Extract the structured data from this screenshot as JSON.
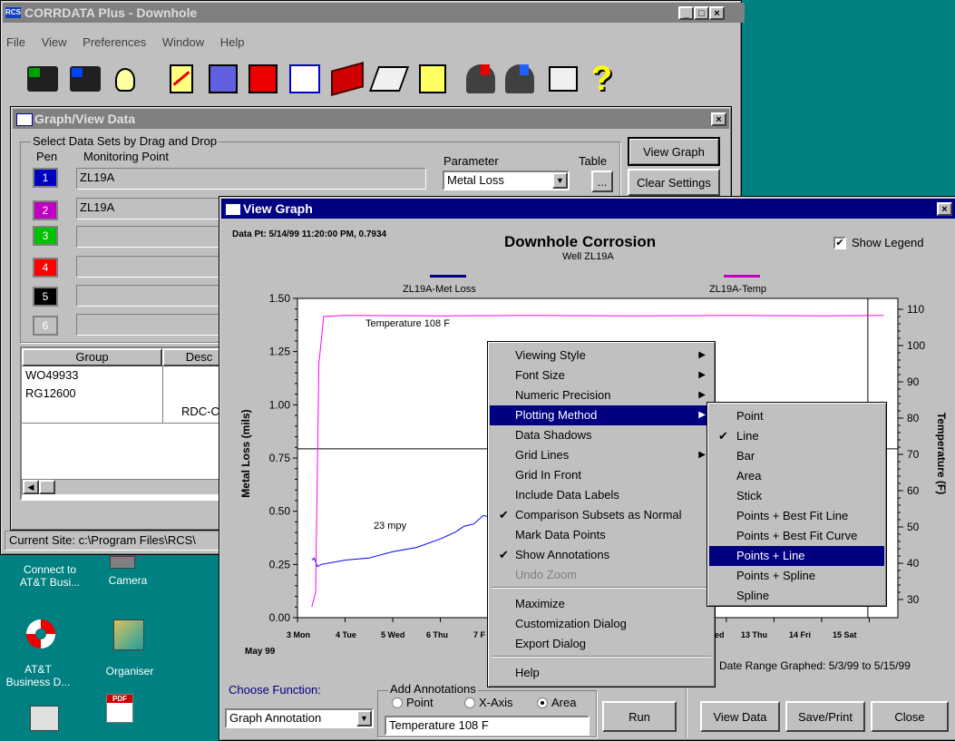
{
  "main_window": {
    "title": "CORRDATA Plus - Downhole",
    "menu": [
      "File",
      "View",
      "Preferences",
      "Window",
      "Help"
    ],
    "status": "Current Site: c:\\Program Files\\RCS\\"
  },
  "graph_view_data": {
    "title": "Graph/View Data",
    "group_title": "Select Data Sets by Drag and Drop",
    "col_pen": "Pen",
    "col_monitoring": "Monitoring Point",
    "col_parameter": "Parameter",
    "col_table": "Table",
    "pens": [
      {
        "num": "1",
        "color": "#0000c0",
        "point": "ZL19A"
      },
      {
        "num": "2",
        "color": "#c000c0",
        "point": "ZL19A"
      },
      {
        "num": "3",
        "color": "#00c000",
        "point": ""
      },
      {
        "num": "4",
        "color": "#ff0000",
        "point": ""
      },
      {
        "num": "5",
        "color": "#000000",
        "point": ""
      },
      {
        "num": "6",
        "color": "#c0c0c0",
        "point": ""
      }
    ],
    "parameter_value": "Metal Loss",
    "table_btn": "...",
    "view_graph_btn": "View Graph",
    "clear_settings_btn": "Clear Settings",
    "group_header": "Group",
    "desc_header": "Desc",
    "groups": [
      "WO49933",
      "RG12600",
      ""
    ],
    "desc_values": [
      "",
      "",
      "RDC-CO"
    ]
  },
  "view_graph": {
    "title": "View Graph",
    "data_pt": "Data Pt: 5/14/99 11:20:00 PM, 0.7934",
    "chart_title": "Downhole Corrosion",
    "chart_subtitle": "Well ZL19A",
    "show_legend": "Show Legend",
    "legend": [
      {
        "name": "ZL19A-Met Loss",
        "color": "#000080"
      },
      {
        "name": "ZL19A-Temp",
        "color": "#c000c0"
      }
    ],
    "ylabel_left": "Metal Loss (mils)",
    "ylabel_right": "Temperature (F)",
    "annotation_temp": "Temperature 108 F",
    "annotation_mpy": "23 mpy",
    "x_ticks_left": [
      "3 Mon",
      "4 Tue",
      "5 Wed",
      "6 Thu",
      "7 F"
    ],
    "x_ticks_right": [
      "ed",
      "13 Thu",
      "14 Fri",
      "15 Sat"
    ],
    "month_label": "May 99",
    "date_range": "Date Range Graphed: 5/3/99 to 5/15/99",
    "choose_function_label": "Choose Function:",
    "choose_function_value": "Graph Annotation",
    "add_annotations_label": "Add Annotations",
    "radio_point": "Point",
    "radio_xaxis": "X-Axis",
    "radio_area": "Area",
    "annotation_text": "Temperature 108 F",
    "run_btn": "Run",
    "view_data_btn": "View Data",
    "save_print_btn": "Save/Print",
    "close_btn": "Close"
  },
  "context_menu": [
    {
      "label": "Viewing Style",
      "submenu": true
    },
    {
      "label": "Font Size",
      "submenu": true
    },
    {
      "label": "Numeric Precision",
      "submenu": true
    },
    {
      "label": "Plotting Method",
      "submenu": true,
      "selected": true
    },
    {
      "label": "Data Shadows"
    },
    {
      "label": "Grid Lines",
      "submenu": true
    },
    {
      "label": "Grid In Front"
    },
    {
      "label": "Include Data Labels"
    },
    {
      "label": "Comparison Subsets as Normal",
      "checked": true
    },
    {
      "label": "Mark Data Points"
    },
    {
      "label": "Show Annotations",
      "checked": true
    },
    {
      "label": "Undo Zoom",
      "disabled": true
    },
    {
      "label": "Maximize"
    },
    {
      "label": "Customization Dialog"
    },
    {
      "label": "Export Dialog"
    },
    {
      "label": "Help"
    }
  ],
  "submenu": [
    {
      "label": "Point"
    },
    {
      "label": "Line",
      "checked": true
    },
    {
      "label": "Bar"
    },
    {
      "label": "Area"
    },
    {
      "label": "Stick"
    },
    {
      "label": "Points + Best Fit Line"
    },
    {
      "label": "Points + Best Fit Curve"
    },
    {
      "label": "Points + Line",
      "selected": true
    },
    {
      "label": "Points + Spline"
    },
    {
      "label": "Spline"
    }
  ],
  "desktop": [
    {
      "label": "Connect to AT&T Busi...",
      "icon": "connect-icon"
    },
    {
      "label": "Camera",
      "icon": "camera-icon"
    },
    {
      "label": "AT&T Business D...",
      "icon": "lifebuoy-icon"
    },
    {
      "label": "Organiser",
      "icon": "organiser-icon"
    }
  ],
  "chart_data": {
    "type": "line",
    "title": "Downhole Corrosion",
    "subtitle": "Well ZL19A",
    "ylabel": "Metal Loss (mils)",
    "y2label": "Temperature (F)",
    "ylim": [
      0,
      1.5
    ],
    "y2lim": [
      25,
      113
    ],
    "y_ticks": [
      "0.00",
      "0.25",
      "0.50",
      "0.75",
      "1.00",
      "1.25",
      "1.50"
    ],
    "y2_ticks": [
      "30",
      "40",
      "50",
      "60",
      "70",
      "80",
      "90",
      "100",
      "110"
    ],
    "series": [
      {
        "name": "ZL19A-Met Loss",
        "color": "#0000ff",
        "axis": "left",
        "x": [
          3.3,
          3.35,
          3.42,
          3.5,
          4.0,
          4.5,
          5.0,
          5.5,
          6.0,
          6.3,
          6.5,
          6.7,
          6.9,
          7.1,
          7.3
        ],
        "y": [
          0.27,
          0.28,
          0.24,
          0.25,
          0.27,
          0.28,
          0.31,
          0.33,
          0.37,
          0.4,
          0.43,
          0.44,
          0.48,
          0.47,
          0.5
        ]
      },
      {
        "name": "ZL19A-Temp",
        "color": "#ff00ff",
        "axis": "right",
        "x": [
          3.3,
          3.38,
          3.45,
          3.55,
          4.0,
          6.0,
          8.0,
          10.0,
          12.0,
          14.0,
          15.3
        ],
        "y": [
          28,
          32,
          95,
          108,
          108.3,
          108.2,
          108.3,
          108.2,
          108.3,
          108.2,
          108.3
        ]
      }
    ]
  }
}
